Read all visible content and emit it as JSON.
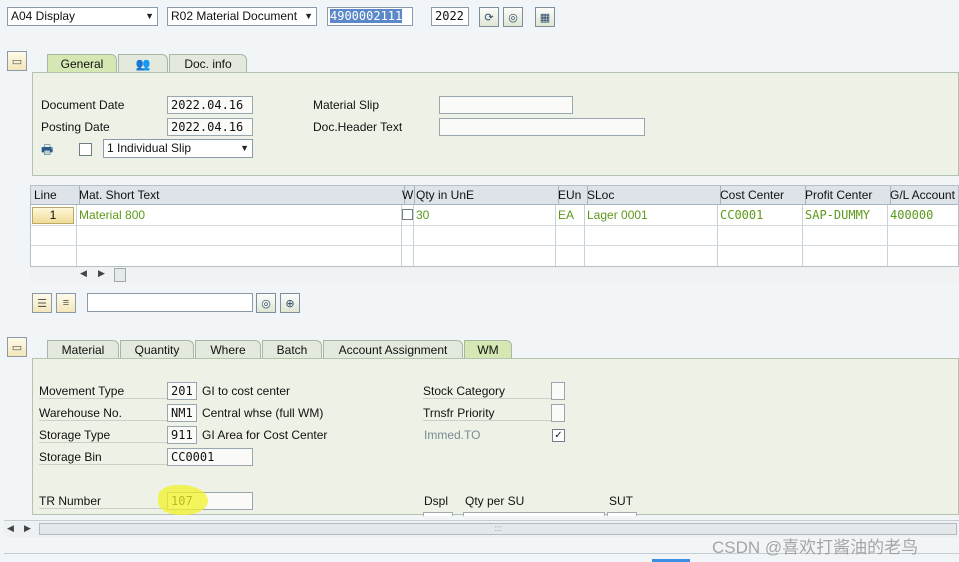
{
  "toolbar": {
    "action_value": "A04 Display",
    "ref_value": "R02 Material Document",
    "doc_number": "4900002111",
    "year": "2022"
  },
  "header_tabs": {
    "general": "General",
    "doc_info": "Doc. info"
  },
  "header": {
    "doc_date_label": "Document Date",
    "doc_date_value": "2022.04.16",
    "post_date_label": "Posting Date",
    "post_date_value": "2022.04.16",
    "material_slip_label": "Material Slip",
    "material_slip_value": "",
    "doc_header_text_label": "Doc.Header Text",
    "doc_header_text_value": "",
    "slip_select_value": "1 Individual Slip"
  },
  "grid": {
    "columns": [
      "Line",
      "Mat. Short Text",
      "W",
      "Qty in UnE",
      "EUn",
      "SLoc",
      "Cost Center",
      "Profit Center",
      "G/L Account"
    ],
    "row": {
      "line": "1",
      "mat_text": "Material 800",
      "qty": "30",
      "eun": "EA",
      "sloc": "Lager 0001",
      "cost_center": "CC0001",
      "profit_center": "SAP-DUMMY",
      "gl_account": "400000"
    },
    "search_value": ""
  },
  "item_tabs": [
    "Material",
    "Quantity",
    "Where",
    "Batch",
    "Account Assignment",
    "WM"
  ],
  "wm": {
    "mvt_label": "Movement Type",
    "mvt_value": "201",
    "mvt_desc": "GI to cost center",
    "wh_label": "Warehouse No.",
    "wh_value": "NM1",
    "wh_desc": "Central whse (full WM)",
    "st_label": "Storage Type",
    "st_value": "911",
    "st_desc": "GI Area for Cost Center",
    "sb_label": "Storage Bin",
    "sb_value": "CC0001",
    "stock_cat_label": "Stock Category",
    "trnsfr_label": "Trnsfr Priority",
    "immed_label": "Immed.TO",
    "tr_label": "TR Number",
    "tr_value": "107",
    "dspl_label": "Dspl",
    "qty_su_label": "Qty per SU",
    "sut_label": "SUT"
  },
  "watermark": "CSDN @喜欢打酱油的老鸟",
  "colors": {
    "panel_bg": "#eef2e6",
    "active_tab": "#d5e8b4",
    "value_green": "#5d9a1a",
    "highlight": "#f2f23a"
  }
}
